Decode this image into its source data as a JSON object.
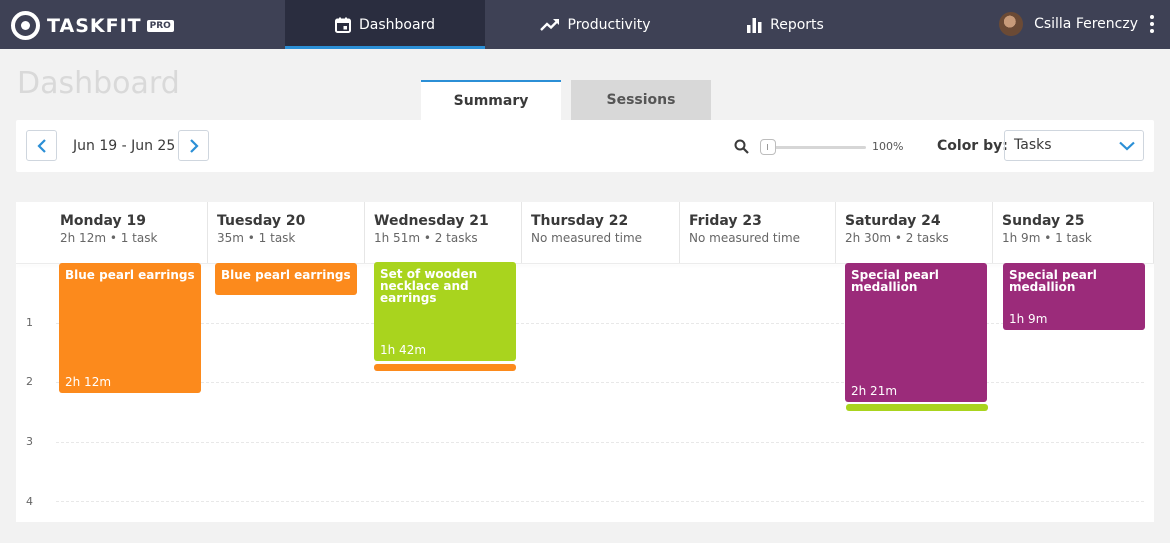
{
  "app": {
    "name": "TASKFIT",
    "badge": "PRO"
  },
  "nav": {
    "tabs": [
      {
        "label": "Dashboard",
        "icon": "calendar-icon",
        "active": true
      },
      {
        "label": "Productivity",
        "icon": "trend-icon",
        "active": false
      },
      {
        "label": "Reports",
        "icon": "bar-chart-icon",
        "active": false
      }
    ]
  },
  "user": {
    "name": "Csilla Ferenczy"
  },
  "page": {
    "title": "Dashboard"
  },
  "subtabs": [
    {
      "label": "Summary",
      "active": true
    },
    {
      "label": "Sessions",
      "active": false
    }
  ],
  "toolbar": {
    "date_range": "Jun 19 - Jun 25",
    "zoom_value": "100%",
    "zoom_level": 0,
    "color_by_label": "Color by:",
    "color_by_value": "Tasks"
  },
  "colors": {
    "orange": "#fc8a1c",
    "green": "#a9d41e",
    "purple": "#9b2b7a",
    "accent": "#2b8fd6",
    "nav_bg": "#3e4155"
  },
  "calendar": {
    "hour_labels": [
      "1",
      "2",
      "3",
      "4"
    ],
    "days": [
      {
        "name": "Monday 19",
        "meta": "2h 12m • 1 task"
      },
      {
        "name": "Tuesday 20",
        "meta": "35m • 1 task"
      },
      {
        "name": "Wednesday 21",
        "meta": "1h 51m •  2 tasks"
      },
      {
        "name": "Thursday 22",
        "meta": "No measured time"
      },
      {
        "name": "Friday 23",
        "meta": "No measured time"
      },
      {
        "name": "Saturday 24",
        "meta": "2h 30m • 2 tasks"
      },
      {
        "name": "Sunday 25",
        "meta": "1h 9m • 1 task"
      }
    ],
    "blocks": [
      {
        "day": "Monday 19",
        "title": "Blue pearl earrings",
        "duration": "2h 12m",
        "color": "#fc8a1c"
      },
      {
        "day": "Tuesday 20",
        "title": "Blue pearl earrings",
        "duration": "",
        "color": "#fc8a1c"
      },
      {
        "day": "Wednesday 21",
        "title": "Set of wooden necklace and earrings",
        "duration": "1h 42m",
        "color": "#a9d41e"
      },
      {
        "day": "Saturday 24",
        "title": "Special pearl medallion",
        "duration": "2h 21m",
        "color": "#9b2b7a"
      },
      {
        "day": "Sunday 25",
        "title": "Special pearl medallion",
        "duration": "1h 9m",
        "color": "#9b2b7a"
      }
    ]
  }
}
